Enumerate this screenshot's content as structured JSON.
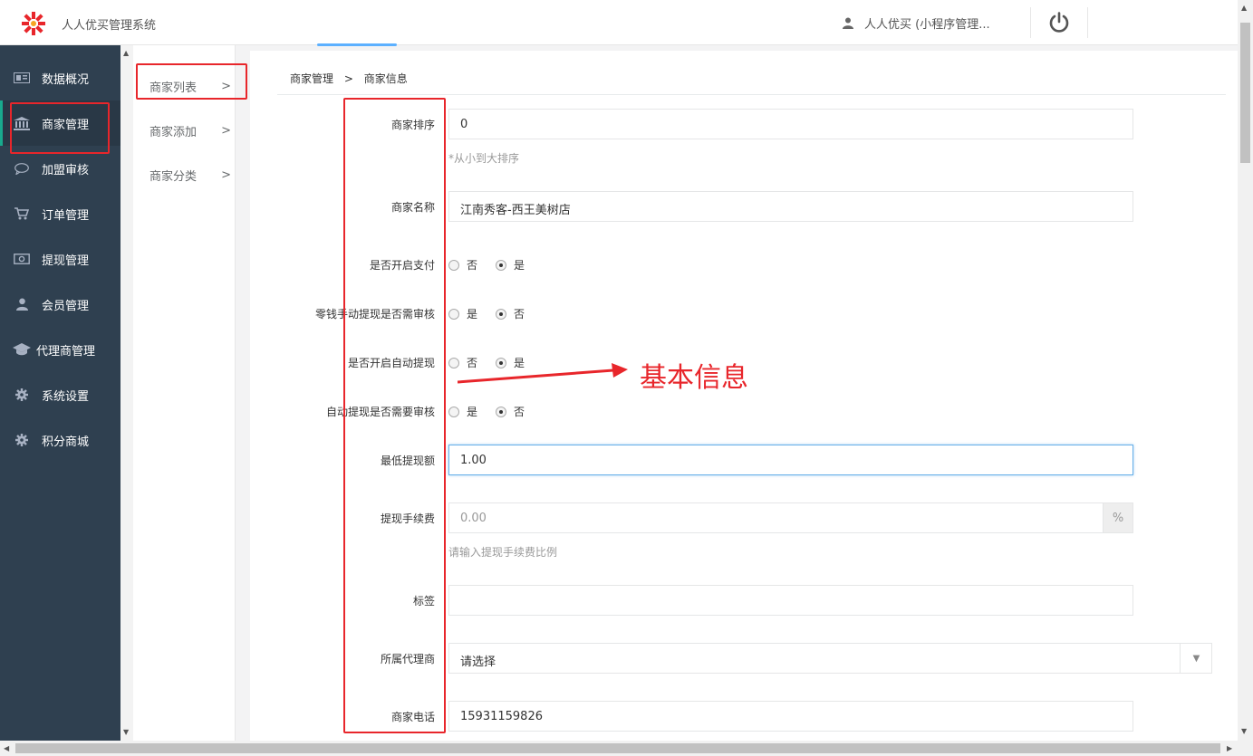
{
  "header": {
    "app_title": "人人优买管理系统",
    "user_name": "人人优买 (小程序管理...",
    "user_icon": "user-icon",
    "logout_icon": "power-icon"
  },
  "sidenav": {
    "items": [
      {
        "label": "数据概况",
        "icon": "dashboard-icon"
      },
      {
        "label": "商家管理",
        "icon": "bank-icon"
      },
      {
        "label": "加盟审核",
        "icon": "chat-bubble-icon"
      },
      {
        "label": "订单管理",
        "icon": "cart-icon"
      },
      {
        "label": "提现管理",
        "icon": "money-icon"
      },
      {
        "label": "会员管理",
        "icon": "user-icon"
      },
      {
        "label": "代理商管理",
        "icon": "graduation-cap-icon"
      },
      {
        "label": "系统设置",
        "icon": "gear-icon"
      },
      {
        "label": "积分商城",
        "icon": "gear-icon"
      }
    ]
  },
  "subnav": {
    "items": [
      {
        "label": "商家列表",
        "arrow": ">"
      },
      {
        "label": "商家添加",
        "arrow": ">"
      },
      {
        "label": "商家分类",
        "arrow": ">"
      }
    ]
  },
  "breadcrumb": {
    "parent": "商家管理",
    "separator": ">",
    "current": "商家信息"
  },
  "form": {
    "sort": {
      "label": "商家排序",
      "value": "0",
      "hint": "*从小到大排序"
    },
    "name": {
      "label": "商家名称",
      "value": "江南秀客-西王美树店"
    },
    "enable_pay": {
      "label": "是否开启支付",
      "options": [
        "否",
        "是"
      ],
      "selected": "是"
    },
    "manual_withdraw_review": {
      "label": "零钱手动提现是否需审核",
      "options": [
        "是",
        "否"
      ],
      "selected": "否"
    },
    "auto_withdraw": {
      "label": "是否开启自动提现",
      "options": [
        "否",
        "是"
      ],
      "selected": "是"
    },
    "auto_withdraw_review": {
      "label": "自动提现是否需要审核",
      "options": [
        "是",
        "否"
      ],
      "selected": "否"
    },
    "min_withdraw": {
      "label": "最低提现额",
      "value": "1.00"
    },
    "withdraw_fee": {
      "label": "提现手续费",
      "placeholder": "0.00",
      "addon": "%",
      "hint": "请输入提现手续费比例"
    },
    "tags": {
      "label": "标签",
      "value": ""
    },
    "agent": {
      "label": "所属代理商",
      "value": "请选择"
    },
    "phone": {
      "label": "商家电话",
      "value": "15931159826"
    }
  },
  "annotation": {
    "text": "基本信息",
    "color": "#e8262b"
  }
}
